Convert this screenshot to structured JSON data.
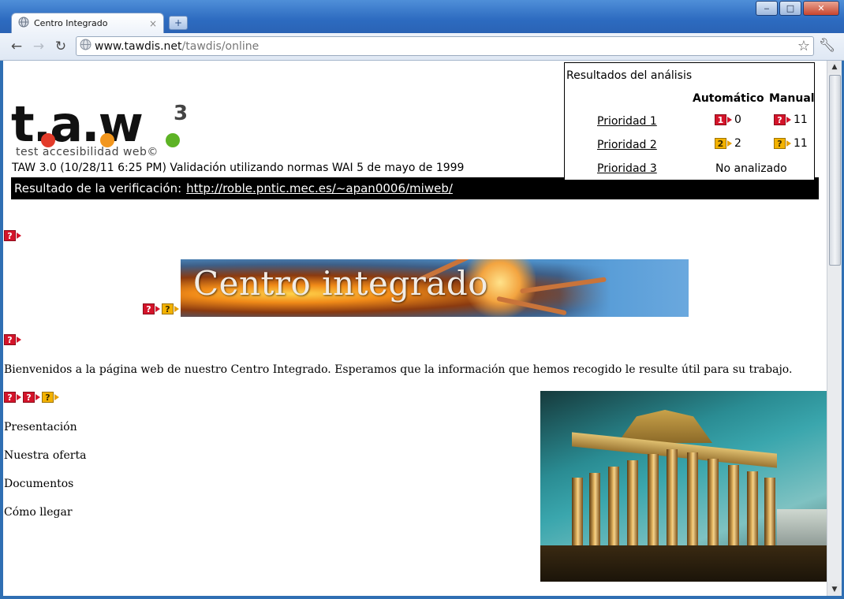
{
  "browser": {
    "tab_title": "Centro Integrado",
    "tab_close": "×",
    "new_tab": "+",
    "url_host": "www.tawdis.net",
    "url_path": "/tawdis/online",
    "window_controls": {
      "minimize": "‒",
      "maximize": "□",
      "close": "✕"
    }
  },
  "taw": {
    "logo_word": "t.a.w",
    "logo_sup": "3",
    "logo_tagline": "test accesibilidad web©",
    "version_line": "TAW 3.0 (10/28/11 6:25 PM) Validación utilizando normas WAI 5 de mayo de 1999",
    "verification_label": "Resultado de la verificación:",
    "verification_url": "http://roble.pntic.mec.es/~apan0006/miweb/"
  },
  "results": {
    "title": "Resultados del análisis",
    "col_auto": "Automático",
    "col_manual": "Manual",
    "rows": [
      {
        "label": "Prioridad 1",
        "auto_icon": "1",
        "auto": "0",
        "manual_icon": "?",
        "manual": "11"
      },
      {
        "label": "Prioridad 2",
        "auto_icon": "2",
        "auto": "2",
        "manual_icon": "?",
        "manual": "11"
      },
      {
        "label": "Prioridad 3",
        "not_analyzed": "No analizado"
      }
    ]
  },
  "page": {
    "banner_text": "Centro integrado",
    "welcome": "Bienvenidos a la página web de nuestro Centro Integrado. Esperamos que la información que hemos recogido le resulte útil para su trabajo.",
    "menu": [
      "Presentación",
      "Nuestra oferta",
      "Documentos",
      "Cómo llegar"
    ]
  },
  "flag_glyph": "?",
  "colors": {
    "flag_red": "#d4142a",
    "flag_yellow": "#f3b200",
    "verification_bar": "#000000"
  }
}
